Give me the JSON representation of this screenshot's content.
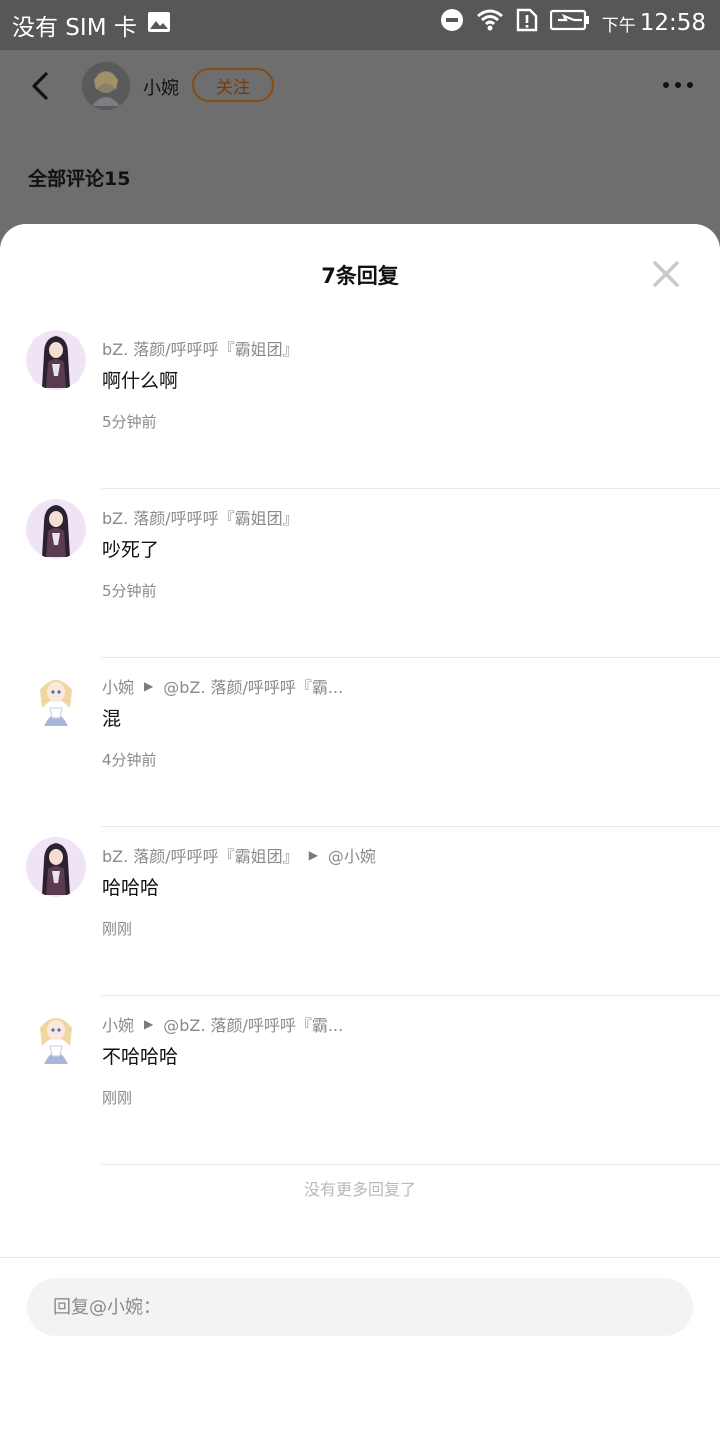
{
  "status_bar": {
    "carrier": "没有 SIM 卡",
    "ampm": "下午",
    "time": "12:58",
    "icons": [
      "image-icon",
      "dnd-icon",
      "wifi-icon",
      "sim-alert-icon",
      "battery-charging-icon"
    ]
  },
  "header": {
    "owner_name": "小婉",
    "follow_label": "关注",
    "all_comments_label": "全部评论15"
  },
  "sheet": {
    "title": "7条回复",
    "no_more": "没有更多回复了",
    "input_placeholder": "回复@小婉："
  },
  "replies": [
    {
      "author": "bZ. 落颜/呼呼呼『霸姐团』",
      "reply_to": "",
      "text": "啊什么啊",
      "time": "5分钟前",
      "avatar": "dark-hair-girl-avatar"
    },
    {
      "author": "bZ. 落颜/呼呼呼『霸姐团』",
      "reply_to": "",
      "text": "吵死了",
      "time": "5分钟前",
      "avatar": "dark-hair-girl-avatar"
    },
    {
      "author": "小婉",
      "reply_to": "@bZ. 落颜/呼呼呼『霸...",
      "text": "混",
      "time": "4分钟前",
      "avatar": "blonde-girl-avatar"
    },
    {
      "author": "bZ. 落颜/呼呼呼『霸姐团』",
      "reply_to": "@小婉",
      "text": "哈哈哈",
      "time": "刚刚",
      "avatar": "dark-hair-girl-avatar"
    },
    {
      "author": "小婉",
      "reply_to": "@bZ. 落颜/呼呼呼『霸...",
      "text": "不哈哈哈",
      "time": "刚刚",
      "avatar": "blonde-girl-avatar"
    }
  ],
  "colors": {
    "overlay_bg": "#6e6e6e",
    "status_bar_bg": "#575757",
    "follow_border": "#8a4a14",
    "meta_text": "#8a8a8a",
    "input_bg": "#f3f3f3"
  }
}
